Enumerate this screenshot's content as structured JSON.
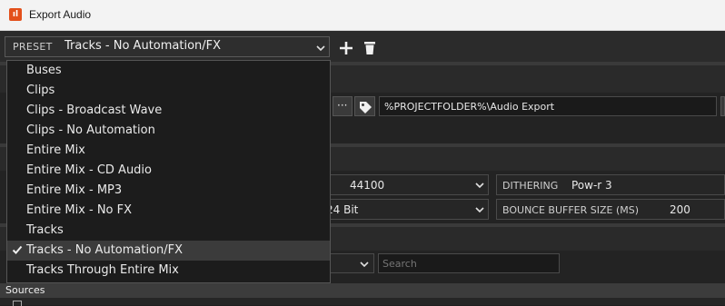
{
  "window": {
    "title": "Export Audio",
    "app_icon_glyph": "ıl"
  },
  "preset": {
    "label": "PRESET",
    "value": "Tracks - No Automation/FX"
  },
  "dropdown": {
    "items": [
      {
        "label": "Buses",
        "selected": false
      },
      {
        "label": "Clips",
        "selected": false
      },
      {
        "label": "Clips - Broadcast Wave",
        "selected": false
      },
      {
        "label": "Clips - No Automation",
        "selected": false
      },
      {
        "label": "Entire Mix",
        "selected": false
      },
      {
        "label": "Entire Mix - CD Audio",
        "selected": false
      },
      {
        "label": "Entire Mix - MP3",
        "selected": false
      },
      {
        "label": "Entire Mix - No FX",
        "selected": false
      },
      {
        "label": "Tracks",
        "selected": false
      },
      {
        "label": "Tracks - No Automation/FX",
        "selected": true
      },
      {
        "label": "Tracks Through Entire Mix",
        "selected": false
      }
    ]
  },
  "location": {
    "path": "%PROJECTFOLDER%\\Audio Export",
    "browse_label": "···"
  },
  "format": {
    "sample_rate": "44100",
    "bit_depth": "24 Bit",
    "dithering_label": "DITHERING",
    "dithering_value": "Pow-r 3",
    "buffer_label": "BOUNCE BUFFER SIZE (MS)",
    "buffer_value": "200"
  },
  "search": {
    "placeholder": "Search"
  },
  "sources": {
    "label": "Sources"
  },
  "colors": {
    "accent": "#e3501b",
    "background": "#1f1f1f",
    "selection": "#3b3b3b"
  }
}
